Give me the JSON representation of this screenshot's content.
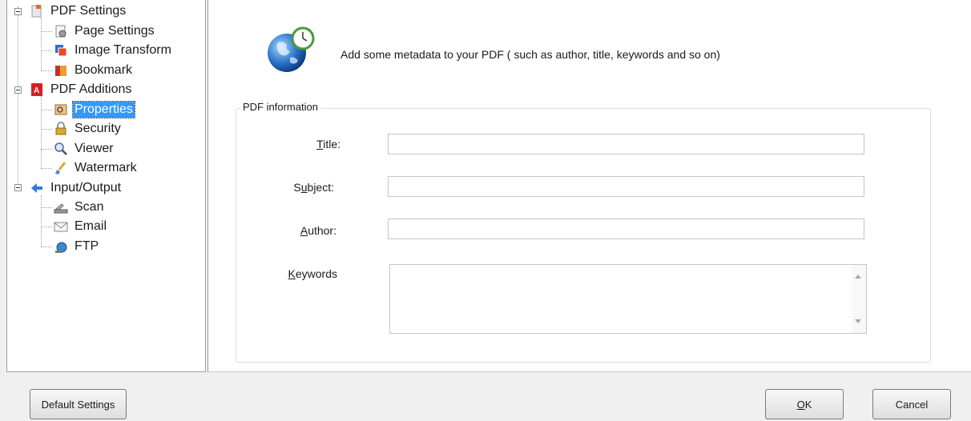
{
  "tree": {
    "items": [
      {
        "label": "PDF Settings",
        "icon": "pdf-settings-icon"
      },
      {
        "label": "Page Settings",
        "icon": "page-settings-icon"
      },
      {
        "label": "Image Transform",
        "icon": "image-transform-icon"
      },
      {
        "label": "Bookmark",
        "icon": "bookmark-icon"
      },
      {
        "label": "PDF Additions",
        "icon": "pdf-additions-icon"
      },
      {
        "label": "Properties",
        "icon": "properties-icon",
        "selected": true
      },
      {
        "label": "Security",
        "icon": "security-lock-icon"
      },
      {
        "label": "Viewer",
        "icon": "viewer-magnifier-icon"
      },
      {
        "label": "Watermark",
        "icon": "watermark-brush-icon"
      },
      {
        "label": "Input/Output",
        "icon": "input-output-arrow-icon"
      },
      {
        "label": "Scan",
        "icon": "scanner-icon"
      },
      {
        "label": "Email",
        "icon": "email-envelope-icon"
      },
      {
        "label": "FTP",
        "icon": "ftp-icon"
      }
    ]
  },
  "main": {
    "intro": "Add some metadata to your PDF ( such as author, title, keywords and so on)",
    "group_title": "PDF information",
    "fields": {
      "title": {
        "label_pre": "",
        "label_u": "T",
        "label_post": "itle:",
        "value": ""
      },
      "subject": {
        "label_pre": "S",
        "label_u": "u",
        "label_post": "bject:",
        "value": ""
      },
      "author": {
        "label_pre": "",
        "label_u": "A",
        "label_post": "uthor:",
        "value": ""
      },
      "keywords": {
        "label_pre": "",
        "label_u": "K",
        "label_post": "eywords",
        "value": ""
      }
    }
  },
  "footer": {
    "default_settings": "Default Settings",
    "ok_u": "O",
    "ok_rest": "K",
    "cancel": "Cancel"
  },
  "colors": {
    "selection": "#3399ff",
    "pdf_red": "#d42020",
    "arrow_blue": "#2a7de1"
  }
}
